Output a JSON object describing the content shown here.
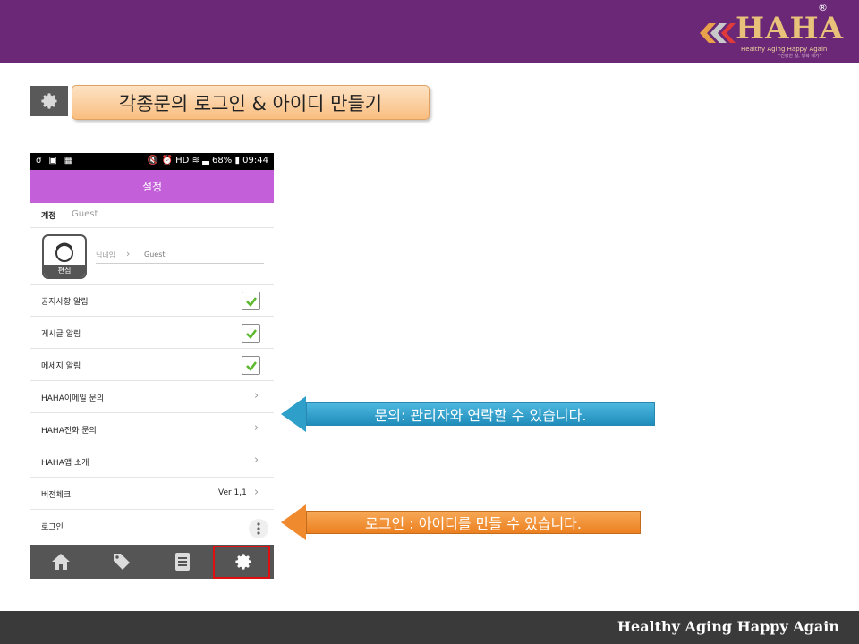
{
  "header": {
    "logo_text": "HAHA",
    "logo_registered": "®",
    "logo_tagline": "Healthy Aging Happy Again",
    "logo_subtagline": "\"건강한 삶, 행복 재기\""
  },
  "slide": {
    "title": "각종문의 로그인 & 아이디 만들기"
  },
  "phone": {
    "status_time": "09:44",
    "status_battery": "68%",
    "app_title": "설정",
    "account_label": "계정",
    "account_value": "Guest",
    "avatar_edit": "편집",
    "nickname_label": "닉네임",
    "nickname_value": "Guest",
    "rows": [
      {
        "label": "공지사항 알림",
        "checked": true
      },
      {
        "label": "게시글 알림",
        "checked": true
      },
      {
        "label": "메세지 알림",
        "checked": true
      }
    ],
    "links": [
      {
        "label": "HAHA이메일 문의"
      },
      {
        "label": "HAHA전화 문의"
      },
      {
        "label": "HAHA앱 소개"
      },
      {
        "label": "버전체크",
        "value": "Ver 1,1"
      },
      {
        "label": "로그인"
      }
    ],
    "nav": [
      "home-icon",
      "tag-icon",
      "list-icon",
      "gear-icon"
    ],
    "accent_color": "#c35fd9"
  },
  "callouts": {
    "inquiry": "문의: 관리자와 연락할 수 있습니다.",
    "login": "로그인 : 아이디를 만들 수 있습니다."
  },
  "footer": {
    "text": "Healthy Aging Happy Again"
  }
}
